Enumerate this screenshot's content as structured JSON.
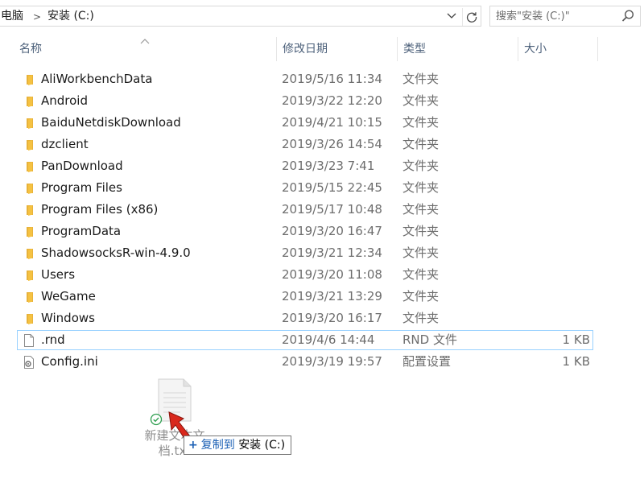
{
  "address_bar": {
    "crumbs": [
      "电脑",
      "安装 (C:)"
    ],
    "separator": ">",
    "dropdown_icon": "chevron-down-icon",
    "refresh_icon": "refresh-icon"
  },
  "search": {
    "placeholder": "搜索\"安装 (C:)\"",
    "icon": "search-icon"
  },
  "columns": {
    "name": "名称",
    "date": "修改日期",
    "type": "类型",
    "size": "大小",
    "sorted_by": "name"
  },
  "files": [
    {
      "name": "AliWorkbenchData",
      "date": "2019/5/16 11:34",
      "type": "文件夹",
      "size": "",
      "icon": "folder-icon"
    },
    {
      "name": "Android",
      "date": "2019/3/22 12:20",
      "type": "文件夹",
      "size": "",
      "icon": "folder-icon"
    },
    {
      "name": "BaiduNetdiskDownload",
      "date": "2019/4/21 10:15",
      "type": "文件夹",
      "size": "",
      "icon": "folder-icon"
    },
    {
      "name": "dzclient",
      "date": "2019/3/26 14:54",
      "type": "文件夹",
      "size": "",
      "icon": "folder-icon"
    },
    {
      "name": "PanDownload",
      "date": "2019/3/23 7:41",
      "type": "文件夹",
      "size": "",
      "icon": "folder-icon"
    },
    {
      "name": "Program Files",
      "date": "2019/5/15 22:45",
      "type": "文件夹",
      "size": "",
      "icon": "folder-icon"
    },
    {
      "name": "Program Files (x86)",
      "date": "2019/5/17 10:48",
      "type": "文件夹",
      "size": "",
      "icon": "folder-icon"
    },
    {
      "name": "ProgramData",
      "date": "2019/3/20 16:47",
      "type": "文件夹",
      "size": "",
      "icon": "folder-icon"
    },
    {
      "name": "ShadowsocksR-win-4.9.0",
      "date": "2019/3/21 12:34",
      "type": "文件夹",
      "size": "",
      "icon": "folder-icon"
    },
    {
      "name": "Users",
      "date": "2019/3/20 11:08",
      "type": "文件夹",
      "size": "",
      "icon": "folder-icon"
    },
    {
      "name": "WeGame",
      "date": "2019/3/21 13:29",
      "type": "文件夹",
      "size": "",
      "icon": "folder-icon"
    },
    {
      "name": "Windows",
      "date": "2019/3/20 16:17",
      "type": "文件夹",
      "size": "",
      "icon": "folder-icon"
    },
    {
      "name": ".rnd",
      "date": "2019/4/6 14:44",
      "type": "RND 文件",
      "size": "1 KB",
      "icon": "file-icon",
      "selected": true
    },
    {
      "name": "Config.ini",
      "date": "2019/3/19 19:57",
      "type": "配置设置",
      "size": "1 KB",
      "icon": "config-file-icon"
    }
  ],
  "drag": {
    "item_label": "新建文本文档.txt",
    "tooltip_plus": "+",
    "tooltip_action": "复制到",
    "tooltip_target": "安装 (C:)"
  },
  "colors": {
    "folder": "#f5c242",
    "selection_border": "#99d1ff",
    "header_text": "#4c607a",
    "secondary_text": "#6d6d6d",
    "cursor_red": "#d9281c",
    "tooltip_accent": "#1a5fb4"
  }
}
